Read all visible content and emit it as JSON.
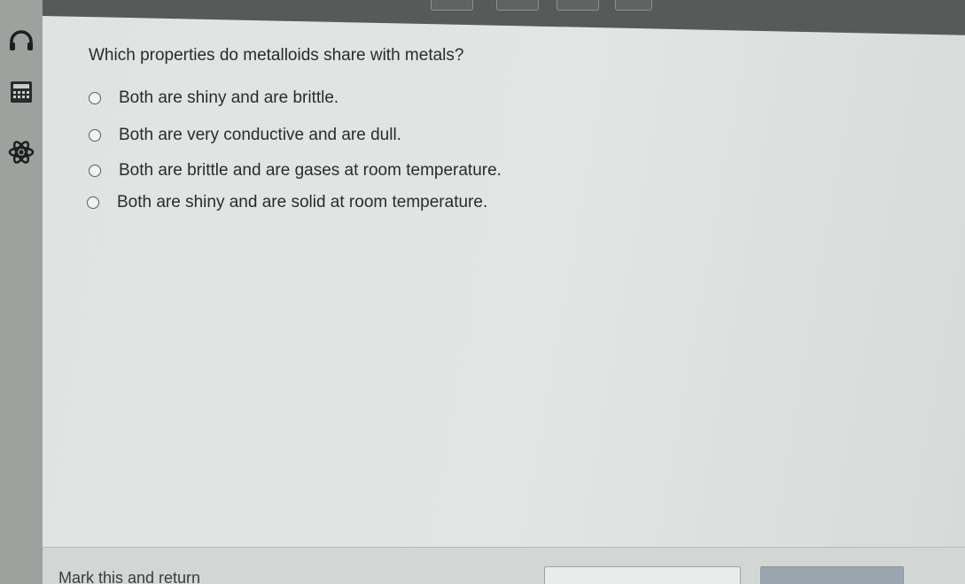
{
  "question": {
    "text": "Which properties do metalloids share with metals?",
    "options": [
      {
        "label": "Both are shiny and are brittle."
      },
      {
        "label": "Both are very conductive and are dull."
      },
      {
        "label": "Both are brittle and are gases at room temperature."
      },
      {
        "label": "Both are shiny and are solid at room temperature."
      }
    ]
  },
  "footer": {
    "mark_label": "Mark this and return"
  },
  "tools": [
    {
      "icon": "headphones-icon"
    },
    {
      "icon": "calculator-icon"
    },
    {
      "icon": "atom-icon"
    }
  ]
}
